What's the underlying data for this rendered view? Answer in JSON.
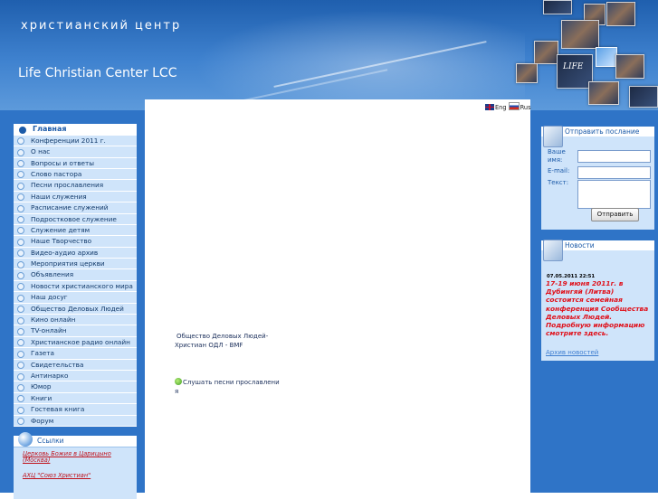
{
  "header": {
    "title": "христианский центр",
    "subtitle": "Life Christian Center LCC",
    "photo_logo": "LIFE"
  },
  "languages": [
    {
      "label": "Eng",
      "flag": "uk-flag-icon"
    },
    {
      "label": "Rus",
      "flag": "russia-flag-icon"
    }
  ],
  "menu": [
    {
      "label": "Главная",
      "active": true
    },
    {
      "label": "Конференции 2011 г."
    },
    {
      "label": "О нас"
    },
    {
      "label": "Вопросы и ответы"
    },
    {
      "label": "Слово пастора"
    },
    {
      "label": "Песни прославления"
    },
    {
      "label": "Наши служения"
    },
    {
      "label": "Расписание служений"
    },
    {
      "label": "Подростковое служение"
    },
    {
      "label": "Служение детям"
    },
    {
      "label": "Наше Творчество"
    },
    {
      "label": "Видео-аудио архив"
    },
    {
      "label": "Мероприятия церкви"
    },
    {
      "label": "Объявления"
    },
    {
      "label": "Новости христианского мира"
    },
    {
      "label": "Наш досуг"
    },
    {
      "label": "Общество Деловых Людей"
    },
    {
      "label": "Кино онлайн"
    },
    {
      "label": "TV-онлайн"
    },
    {
      "label": "Христианское радио онлайн"
    },
    {
      "label": "Газета"
    },
    {
      "label": "Свидетельства"
    },
    {
      "label": "Антинарко"
    },
    {
      "label": "Юмор"
    },
    {
      "label": "Книги"
    },
    {
      "label": "Гостевая книга"
    },
    {
      "label": "Форум"
    }
  ],
  "links_box": {
    "title": "Ссылки",
    "links": [
      "Церковь Божия в Царицыно (Москва)",
      "АХЦ \"Союз Христиан\""
    ]
  },
  "center": {
    "business_link_line1": "Общество Деловых Людей-",
    "business_link_line2": "Христиан  ОДЛ - BMF",
    "songs_link_line1": "Слушать песни прославлени",
    "songs_link_line2": "я"
  },
  "message_panel": {
    "title": "Отправить послание",
    "name_label_line1": "Ваше",
    "name_label_line2": "имя:",
    "email_label": "E-mail:",
    "text_label": "Текст:",
    "submit_label": "Отправить",
    "name_value": "",
    "email_value": "",
    "text_value": ""
  },
  "news_panel": {
    "title": "Новости",
    "date": "07.05.2011 22:51",
    "text": "17-19 июня  2011г. в Дубингяй (Литва) состоится семейная конференция Сообщества Деловых Людей. Подробную информацию смотрите здесь.",
    "archive_label": "Архив новостей"
  },
  "colors": {
    "sidebar": "#2f74c7",
    "menu_item_bg": "#cfe4fa",
    "accent": "#1b5aa8",
    "news_text": "#e0101a"
  }
}
